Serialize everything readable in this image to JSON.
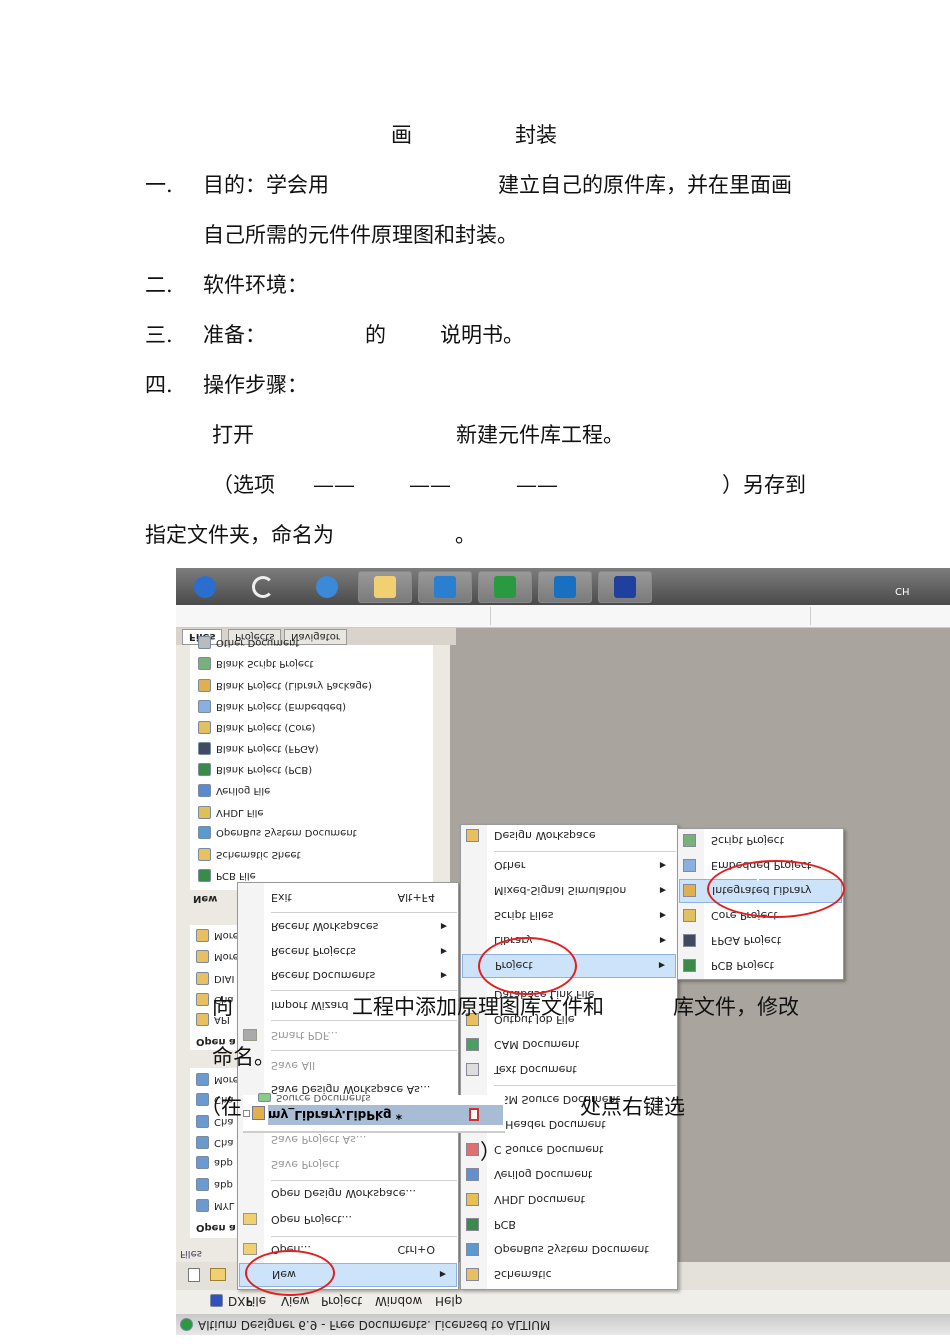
{
  "doc": {
    "title_a": "画",
    "title_b": "封装",
    "l1_num": "一.",
    "l1_a": "目的：学会用",
    "l1_b": "建立自己的原件库，并在里面画",
    "l1_c": "自己所需的元件件原理图和封装。",
    "l2_num": "二.",
    "l2": "软件环境：",
    "l3_num": "三.",
    "l3_a": "准备：",
    "l3_b": "的",
    "l3_c": "说明书。",
    "l4_num": "四.",
    "l4": "操作步骤：",
    "s1_a": "打开",
    "s1_b": "新建元件库工程。",
    "s2_a": "（选项",
    "s2_d1": "——",
    "s2_d2": "——",
    "s2_d3": "——",
    "s2_e": "）另存到",
    "s3_a": "指定文件夹，命名为",
    "s3_b": "。",
    "o1_a": "向",
    "o1_b": "工程中添加原理图库文件和",
    "o1_c": "库文件，修改",
    "o2": "命名。",
    "o3_a": "（在",
    "o3_b": "处点右键选",
    "o4": "）"
  },
  "app": {
    "title_bar": "Altium Designer 6.9 - Free Documents. Licensed to ALTIUM",
    "menu_bar": [
      "DXP",
      "File",
      "View",
      "Project",
      "Window",
      "Help"
    ],
    "taskbar_tray": "CH",
    "panel_tabs": [
      "Files",
      "Projects",
      "Navigator"
    ],
    "panel_footer": "Files",
    "new_items": [
      "Other Document",
      "Blank Script Project",
      "Blank Project (Library Package)",
      "Blank Project (Embedded)",
      "Blank Project (Core)",
      "Blank Project (FPGA)",
      "Blank Project (PCB)",
      "Verilog File",
      "VHDL File",
      "OpenBus System Document",
      "Schematic Sheet",
      "PCB File"
    ],
    "new_header": "New",
    "group2": [
      "More",
      "More",
      "DIAI",
      "Cha",
      "API",
      "Open a"
    ],
    "group3": [
      "More",
      "Cha",
      "Cha",
      "Cha",
      "abp",
      "abp",
      "MYL",
      "Open a"
    ],
    "file_menu": [
      {
        "label": "Exit",
        "shortcut": "Alt+F4"
      },
      {
        "label": "Recent Workspaces",
        "sub": true
      },
      {
        "label": "Recent Projects",
        "sub": true
      },
      {
        "label": "Recent Documents",
        "sub": true
      },
      {
        "label": "Import Wizard"
      },
      {
        "label": "Smart PDF...",
        "disabled": true
      },
      {
        "label": "Save All",
        "disabled": true
      },
      {
        "label": "Save Design Workspace As..."
      },
      {
        "label": "Save Project As...",
        "disabled": true
      },
      {
        "label": "Save Project",
        "disabled": true
      },
      {
        "label": "Open Design Workspace..."
      },
      {
        "label": "Open Project..."
      },
      {
        "label": "Open...",
        "shortcut": "Ctrl+O"
      },
      {
        "label": "New",
        "sub": true,
        "selected": true
      }
    ],
    "project_tree": {
      "parent": "Source Documents",
      "item": "my_Library.LibPkg *"
    },
    "new_menu": [
      {
        "label": "Design Workspace"
      },
      {
        "label": "Other",
        "sub": true
      },
      {
        "label": "Mixed-Signal Simulation",
        "sub": true
      },
      {
        "label": "Script Files",
        "sub": true
      },
      {
        "label": "Library",
        "sub": true
      },
      {
        "label": "Project",
        "sub": true,
        "selected": true
      },
      {
        "label": "Database Link File"
      },
      {
        "label": "Output Job File"
      },
      {
        "label": "CAM Document"
      },
      {
        "label": "Text Document"
      },
      {
        "label": "ASM Source Document"
      },
      {
        "label": "C Header Document"
      },
      {
        "label": "C Source Document"
      },
      {
        "label": "Verilog Document"
      },
      {
        "label": "VHDL Document"
      },
      {
        "label": "PCB"
      },
      {
        "label": "OpenBus System Document"
      },
      {
        "label": "Schematic"
      }
    ],
    "project_menu": [
      {
        "label": "Script Project"
      },
      {
        "label": "Embedded Project"
      },
      {
        "label": "Integrated Library",
        "selected": true
      },
      {
        "label": "Core Project"
      },
      {
        "label": "FPGA Project"
      },
      {
        "label": "PCB Project"
      }
    ],
    "colors": {
      "highlight": "#cde3fa",
      "annotation": "#e02020",
      "tree_selected": "#a8bcd6"
    }
  }
}
